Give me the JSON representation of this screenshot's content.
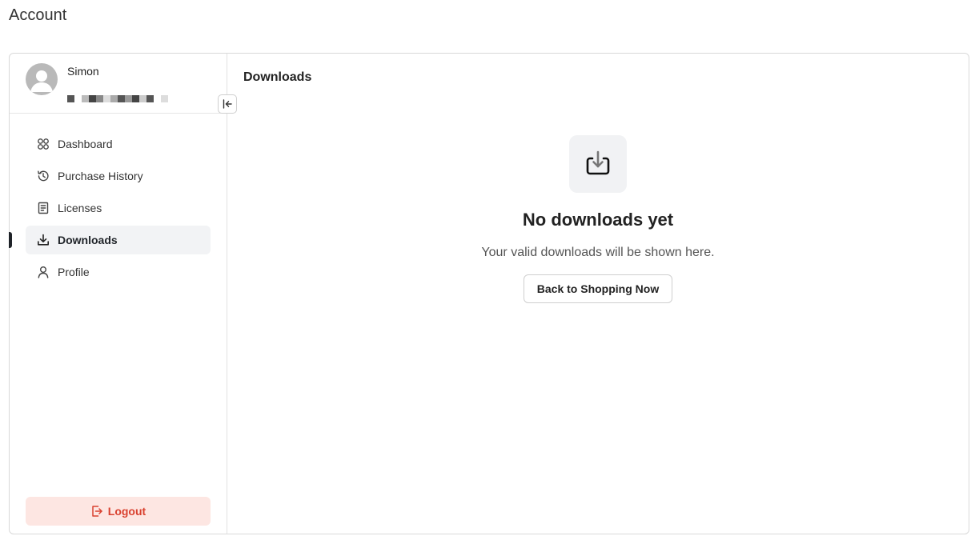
{
  "page": {
    "title": "Account"
  },
  "user": {
    "name": "Simon",
    "email_redacted": true
  },
  "sidebar": {
    "items": [
      {
        "label": "Dashboard",
        "icon": "dashboard-grid-icon"
      },
      {
        "label": "Purchase History",
        "icon": "history-icon"
      },
      {
        "label": "Licenses",
        "icon": "document-icon"
      },
      {
        "label": "Downloads",
        "icon": "download-icon",
        "active": true
      },
      {
        "label": "Profile",
        "icon": "user-icon"
      }
    ],
    "logout_label": "Logout",
    "collapse_icon": "collapse-left-icon"
  },
  "main": {
    "section_title": "Downloads",
    "empty": {
      "icon": "download-tray-icon",
      "title": "No downloads yet",
      "subtitle": "Your valid downloads will be shown here.",
      "button_label": "Back to Shopping Now"
    }
  },
  "colors": {
    "accent_dark": "#1f2328",
    "logout_bg": "#fde6e2",
    "logout_text": "#d9412f",
    "active_bg": "#f2f3f5"
  }
}
